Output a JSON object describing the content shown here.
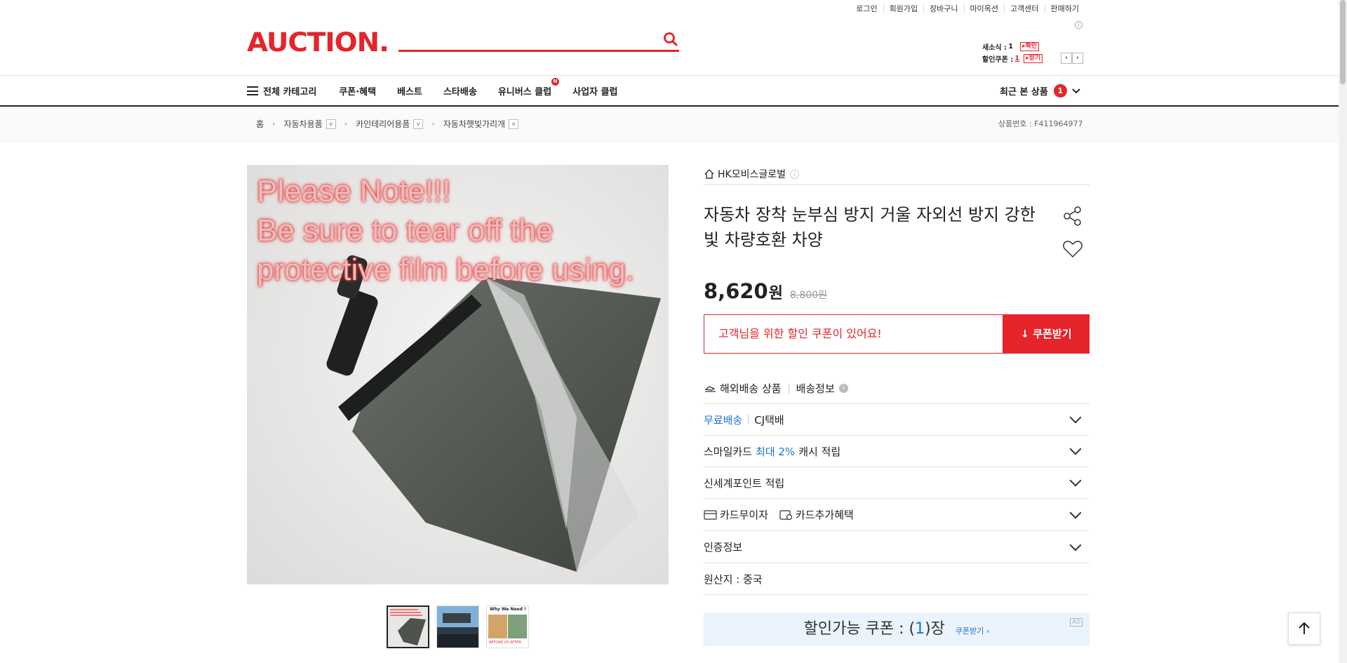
{
  "utility": [
    "로그인",
    "회원가입",
    "장바구니",
    "마이옥션",
    "고객센터",
    "판매하기"
  ],
  "logo": "AUCTION.",
  "search": {
    "value": "",
    "placeholder": ""
  },
  "news": {
    "label1": "새소식 :",
    "count1": "1",
    "btn1": "확인",
    "label2": "할인쿠폰 :",
    "count2": "1",
    "btn2": "받기"
  },
  "nav": {
    "all_categories": "전체 카테고리",
    "items": [
      "쿠폰·혜택",
      "베스트",
      "스타배송",
      "유니버스 클럽",
      "사업자 클럽"
    ],
    "new_badge": "N",
    "recent_label": "최근 본 상품",
    "recent_count": "1"
  },
  "breadcrumb": {
    "home": "홈",
    "c1": "자동차용품",
    "c2": "카인테리어용품",
    "c3": "자동차햇빛가리개"
  },
  "product_no": "상품번호 : F411964977",
  "image_notice": [
    "Please Note!!!",
    "Be sure to tear off the",
    "protective film before using."
  ],
  "seller": "HK모비스글로벌",
  "title": "자동차 장착 눈부심 방지 거울 자외선 방지 강한 빛 차량호환 차양",
  "price": {
    "sale": "8,620",
    "unit": "원",
    "original": "8,800원"
  },
  "coupon": {
    "message": "고객님을 위한 할인 쿠폰이 있어요!",
    "button": "쿠폰받기"
  },
  "shipping": {
    "overseas": "해외배송 상품",
    "info": "배송정보"
  },
  "rows": {
    "free_ship": "무료배송",
    "courier": "CJ택배",
    "smilecard_a": "스마일카드",
    "smilecard_b": "최대 2%",
    "smilecard_c": "캐시 적립",
    "shinsegae": "신세계포인트 적립",
    "card_interest": "카드무이자",
    "card_extra": "카드추가혜택",
    "cert": "인증정보",
    "origin": "원산지 : 중국"
  },
  "available": {
    "text_a": "할인가능 쿠폰 : (",
    "count": "1",
    "text_b": ")장",
    "link": "쿠폰받기 ›",
    "ad": "AD"
  },
  "thumb3_caption": "Why We Need !",
  "thumb3_sub": "BEFORE VS AFTER"
}
